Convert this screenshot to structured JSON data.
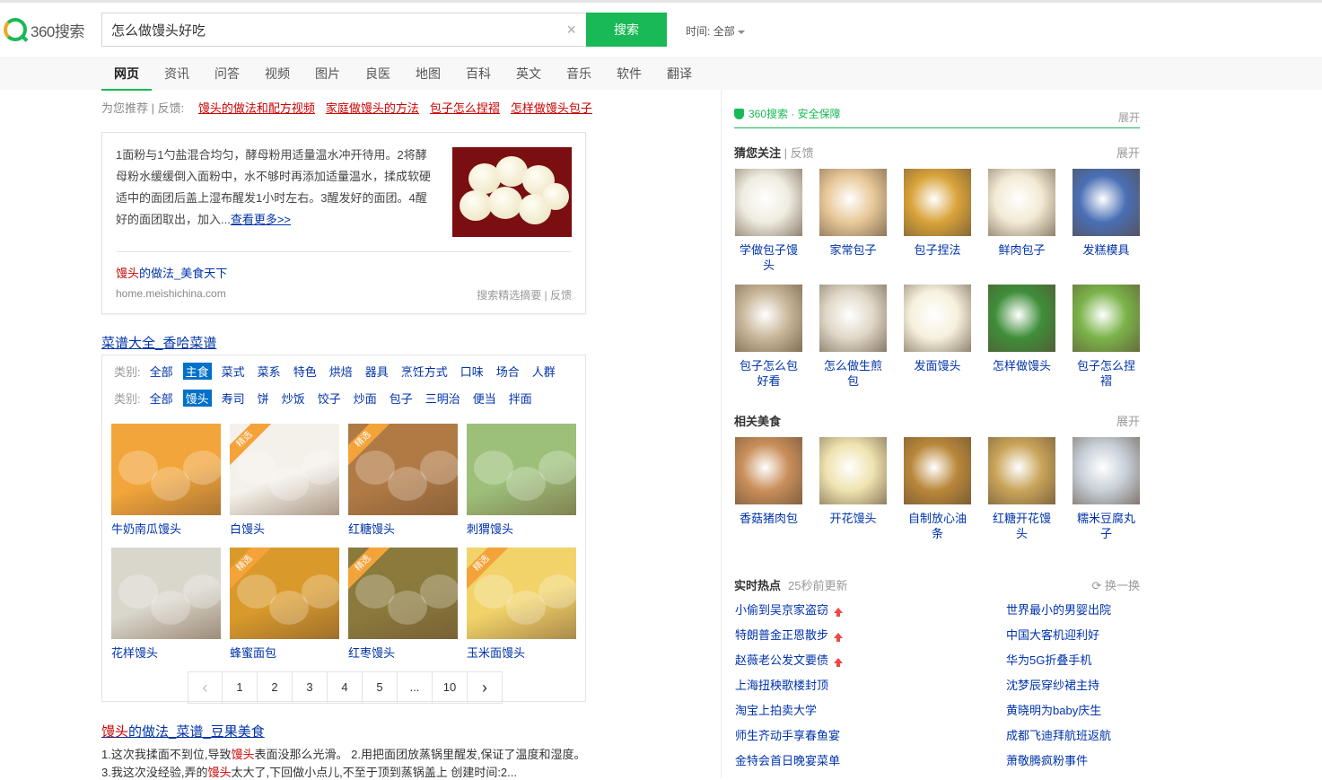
{
  "header": {
    "logo_text": "360搜索",
    "query": "怎么做馒头好吃",
    "clear_glyph": "×",
    "search_button": "搜索",
    "time_label": "时间:",
    "time_value": "全部"
  },
  "nav": {
    "tabs": [
      "网页",
      "资讯",
      "问答",
      "视频",
      "图片",
      "良医",
      "地图",
      "百科",
      "英文",
      "音乐",
      "软件",
      "翻译"
    ],
    "active": "网页"
  },
  "suggest": {
    "label": "为您推荐",
    "feedback": "| 反馈:",
    "links": [
      "馒头的做法和配方视频",
      "家庭做馒头的方法",
      "包子怎么捏褶",
      "怎样做馒头包子"
    ]
  },
  "snippet_card": {
    "text": "1面粉与1勺盐混合均匀，酵母粉用适量温水冲开待用。2将酵母粉水缓缓倒入面粉中，水不够时再添加适量温水，揉成软硬适中的面团后盖上湿布醒发1小时左右。3醒发好的面团。4醒好的面团取出，加入...",
    "more_link": "查看更多>>",
    "title_em": "馒头",
    "title_rest": "的做法_美食天下",
    "url": "home.meishichina.com",
    "meta": "搜索精选摘要 | 反馈"
  },
  "recipe": {
    "title": "菜谱大全_香哈菜谱",
    "row1_label": "类别:",
    "row1": [
      "全部",
      "主食",
      "菜式",
      "菜系",
      "特色",
      "烘焙",
      "器具",
      "烹饪方式",
      "口味",
      "场合",
      "人群"
    ],
    "row1_selected": "主食",
    "row2_label": "类别:",
    "row2": [
      "全部",
      "馒头",
      "寿司",
      "饼",
      "炒饭",
      "饺子",
      "炒面",
      "包子",
      "三明治",
      "便当",
      "拌面"
    ],
    "row2_selected": "馒头",
    "ribbon": "精选",
    "items": [
      {
        "name": "牛奶南瓜馒头",
        "featured": false,
        "color": "#f2a53a"
      },
      {
        "name": "白馒头",
        "featured": true,
        "color": "#f4f1ea"
      },
      {
        "name": "红糖馒头",
        "featured": true,
        "color": "#b07a45"
      },
      {
        "name": "刺猬馒头",
        "featured": false,
        "color": "#9cc07a"
      },
      {
        "name": "花样馒头",
        "featured": false,
        "color": "#d9d6cc"
      },
      {
        "name": "蜂蜜面包",
        "featured": true,
        "color": "#d99a2b"
      },
      {
        "name": "红枣馒头",
        "featured": true,
        "color": "#8a7a3c"
      },
      {
        "name": "玉米面馒头",
        "featured": true,
        "color": "#f1d36a"
      }
    ],
    "pager": [
      "‹",
      "1",
      "2",
      "3",
      "4",
      "5",
      "...",
      "10",
      "›"
    ]
  },
  "result2": {
    "title_em": "馒头",
    "title_rest": "的做法_菜谱_豆果美食",
    "line1_a": "1.这次我揉面不到位,导致",
    "line1_em": "馒头",
    "line1_b": "表面没那么光滑。 2.用把面团放蒸锅里醒发,保证了温度和湿度。",
    "line2_a": "3.我这次没经验,弄的",
    "line2_em": "馒头",
    "line2_b": "太大了,下回做小点儿,不至于顶到蒸锅盖上 创建时间:2..."
  },
  "sidebar": {
    "safe_text": "360搜索 · 安全保障",
    "safe_more": "展开",
    "guess_title": "猜您关注",
    "guess_feedback": "| 反馈",
    "guess_more": "展开",
    "guess_items": [
      {
        "name": "学做包子馒头",
        "color": "#efece0"
      },
      {
        "name": "家常包子",
        "color": "#e8c99a"
      },
      {
        "name": "包子捏法",
        "color": "#d9a33a"
      },
      {
        "name": "鲜肉包子",
        "color": "#f2ead4"
      },
      {
        "name": "发糕模具",
        "color": "#4a6fb5"
      },
      {
        "name": "包子怎么包好看",
        "color": "#c9b79a"
      },
      {
        "name": "怎么做生煎包",
        "color": "#e0d8c8"
      },
      {
        "name": "发面馒头",
        "color": "#f6f1dd"
      },
      {
        "name": "怎样做馒头",
        "color": "#3f8e3a"
      },
      {
        "name": "包子怎么捏褶",
        "color": "#7bb34a"
      }
    ],
    "related_title": "相关美食",
    "related_more": "展开",
    "related_items": [
      {
        "name": "香菇猪肉包",
        "color": "#c98e5a"
      },
      {
        "name": "开花馒头",
        "color": "#efe3b0"
      },
      {
        "name": "自制放心油条",
        "color": "#b9873a"
      },
      {
        "name": "红糖开花馒头",
        "color": "#c9a45a"
      },
      {
        "name": "糯米豆腐丸子",
        "color": "#c7cfd8"
      }
    ],
    "hot_title": "实时热点",
    "hot_time": "25秒前更新",
    "hot_refresh": "换一换",
    "hot_left": [
      {
        "text": "小偷到吴京家盗窃",
        "up": true
      },
      {
        "text": "特朗普金正恩散步",
        "up": true
      },
      {
        "text": "赵薇老公发文要债",
        "up": true
      },
      {
        "text": "上海扭秧歌楼封顶",
        "up": false
      },
      {
        "text": "淘宝上拍卖大学",
        "up": false
      },
      {
        "text": "师生齐动手享春鱼宴",
        "up": false
      },
      {
        "text": "金特会首日晚宴菜单",
        "up": false
      }
    ],
    "hot_right": [
      "世界最小的男婴出院",
      "中国大客机迎利好",
      "华为5G折叠手机",
      "沈梦辰穿纱裙主持",
      "黄晓明为baby庆生",
      "成都飞迪拜航班返航",
      "萧敬腾疯粉事件"
    ]
  }
}
